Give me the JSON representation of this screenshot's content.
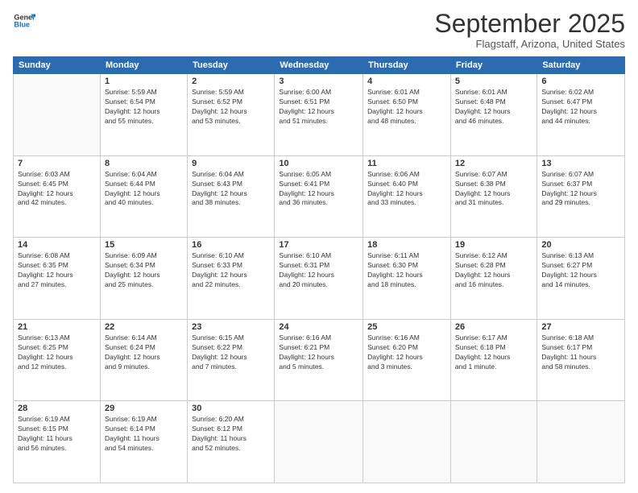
{
  "logo": {
    "line1": "General",
    "line2": "Blue"
  },
  "title": "September 2025",
  "subtitle": "Flagstaff, Arizona, United States",
  "weekdays": [
    "Sunday",
    "Monday",
    "Tuesday",
    "Wednesday",
    "Thursday",
    "Friday",
    "Saturday"
  ],
  "weeks": [
    [
      {
        "day": "",
        "info": ""
      },
      {
        "day": "1",
        "info": "Sunrise: 5:59 AM\nSunset: 6:54 PM\nDaylight: 12 hours\nand 55 minutes."
      },
      {
        "day": "2",
        "info": "Sunrise: 5:59 AM\nSunset: 6:52 PM\nDaylight: 12 hours\nand 53 minutes."
      },
      {
        "day": "3",
        "info": "Sunrise: 6:00 AM\nSunset: 6:51 PM\nDaylight: 12 hours\nand 51 minutes."
      },
      {
        "day": "4",
        "info": "Sunrise: 6:01 AM\nSunset: 6:50 PM\nDaylight: 12 hours\nand 48 minutes."
      },
      {
        "day": "5",
        "info": "Sunrise: 6:01 AM\nSunset: 6:48 PM\nDaylight: 12 hours\nand 46 minutes."
      },
      {
        "day": "6",
        "info": "Sunrise: 6:02 AM\nSunset: 6:47 PM\nDaylight: 12 hours\nand 44 minutes."
      }
    ],
    [
      {
        "day": "7",
        "info": "Sunrise: 6:03 AM\nSunset: 6:45 PM\nDaylight: 12 hours\nand 42 minutes."
      },
      {
        "day": "8",
        "info": "Sunrise: 6:04 AM\nSunset: 6:44 PM\nDaylight: 12 hours\nand 40 minutes."
      },
      {
        "day": "9",
        "info": "Sunrise: 6:04 AM\nSunset: 6:43 PM\nDaylight: 12 hours\nand 38 minutes."
      },
      {
        "day": "10",
        "info": "Sunrise: 6:05 AM\nSunset: 6:41 PM\nDaylight: 12 hours\nand 36 minutes."
      },
      {
        "day": "11",
        "info": "Sunrise: 6:06 AM\nSunset: 6:40 PM\nDaylight: 12 hours\nand 33 minutes."
      },
      {
        "day": "12",
        "info": "Sunrise: 6:07 AM\nSunset: 6:38 PM\nDaylight: 12 hours\nand 31 minutes."
      },
      {
        "day": "13",
        "info": "Sunrise: 6:07 AM\nSunset: 6:37 PM\nDaylight: 12 hours\nand 29 minutes."
      }
    ],
    [
      {
        "day": "14",
        "info": "Sunrise: 6:08 AM\nSunset: 6:35 PM\nDaylight: 12 hours\nand 27 minutes."
      },
      {
        "day": "15",
        "info": "Sunrise: 6:09 AM\nSunset: 6:34 PM\nDaylight: 12 hours\nand 25 minutes."
      },
      {
        "day": "16",
        "info": "Sunrise: 6:10 AM\nSunset: 6:33 PM\nDaylight: 12 hours\nand 22 minutes."
      },
      {
        "day": "17",
        "info": "Sunrise: 6:10 AM\nSunset: 6:31 PM\nDaylight: 12 hours\nand 20 minutes."
      },
      {
        "day": "18",
        "info": "Sunrise: 6:11 AM\nSunset: 6:30 PM\nDaylight: 12 hours\nand 18 minutes."
      },
      {
        "day": "19",
        "info": "Sunrise: 6:12 AM\nSunset: 6:28 PM\nDaylight: 12 hours\nand 16 minutes."
      },
      {
        "day": "20",
        "info": "Sunrise: 6:13 AM\nSunset: 6:27 PM\nDaylight: 12 hours\nand 14 minutes."
      }
    ],
    [
      {
        "day": "21",
        "info": "Sunrise: 6:13 AM\nSunset: 6:25 PM\nDaylight: 12 hours\nand 12 minutes."
      },
      {
        "day": "22",
        "info": "Sunrise: 6:14 AM\nSunset: 6:24 PM\nDaylight: 12 hours\nand 9 minutes."
      },
      {
        "day": "23",
        "info": "Sunrise: 6:15 AM\nSunset: 6:22 PM\nDaylight: 12 hours\nand 7 minutes."
      },
      {
        "day": "24",
        "info": "Sunrise: 6:16 AM\nSunset: 6:21 PM\nDaylight: 12 hours\nand 5 minutes."
      },
      {
        "day": "25",
        "info": "Sunrise: 6:16 AM\nSunset: 6:20 PM\nDaylight: 12 hours\nand 3 minutes."
      },
      {
        "day": "26",
        "info": "Sunrise: 6:17 AM\nSunset: 6:18 PM\nDaylight: 12 hours\nand 1 minute."
      },
      {
        "day": "27",
        "info": "Sunrise: 6:18 AM\nSunset: 6:17 PM\nDaylight: 11 hours\nand 58 minutes."
      }
    ],
    [
      {
        "day": "28",
        "info": "Sunrise: 6:19 AM\nSunset: 6:15 PM\nDaylight: 11 hours\nand 56 minutes."
      },
      {
        "day": "29",
        "info": "Sunrise: 6:19 AM\nSunset: 6:14 PM\nDaylight: 11 hours\nand 54 minutes."
      },
      {
        "day": "30",
        "info": "Sunrise: 6:20 AM\nSunset: 6:12 PM\nDaylight: 11 hours\nand 52 minutes."
      },
      {
        "day": "",
        "info": ""
      },
      {
        "day": "",
        "info": ""
      },
      {
        "day": "",
        "info": ""
      },
      {
        "day": "",
        "info": ""
      }
    ]
  ]
}
